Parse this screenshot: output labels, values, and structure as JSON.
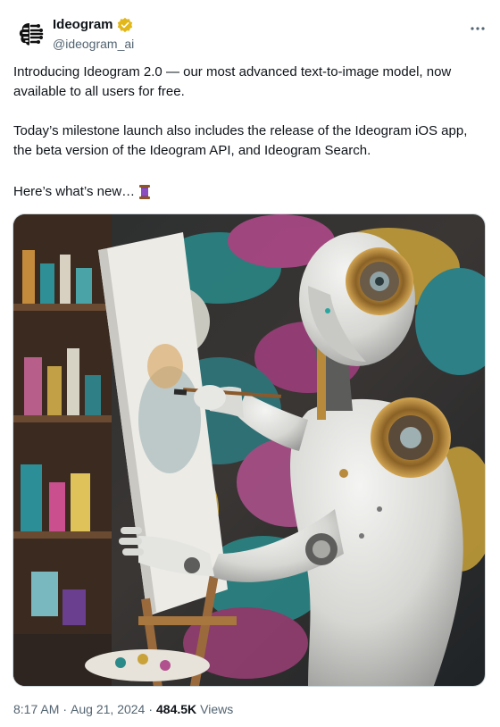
{
  "author": {
    "display_name": "Ideogram",
    "handle": "@ideogram_ai",
    "verified_badge_color": "#e2b719",
    "avatar_icon": "brain-circuit-icon"
  },
  "more_icon": "more-icon",
  "tweet": {
    "paragraph_1": "Introducing Ideogram 2.0 — our most advanced text-to-image model, now available to all users for free.",
    "paragraph_2": "Today’s milestone launch also includes the release of the Ideogram iOS app, the beta version of the Ideogram API, and Ideogram Search.",
    "paragraph_3": "Here’s what’s new…",
    "emoji": "thread-spool-icon"
  },
  "media": {
    "icon": "robot-painting-image"
  },
  "meta": {
    "time": "8:17 AM",
    "separator_1": "·",
    "date": "Aug 21, 2024",
    "separator_2": "·",
    "views_count": "484.5K",
    "views_label": "Views"
  },
  "colors": {
    "text_primary": "#0f1419",
    "text_secondary": "#536471",
    "border": "#cfd9de"
  }
}
